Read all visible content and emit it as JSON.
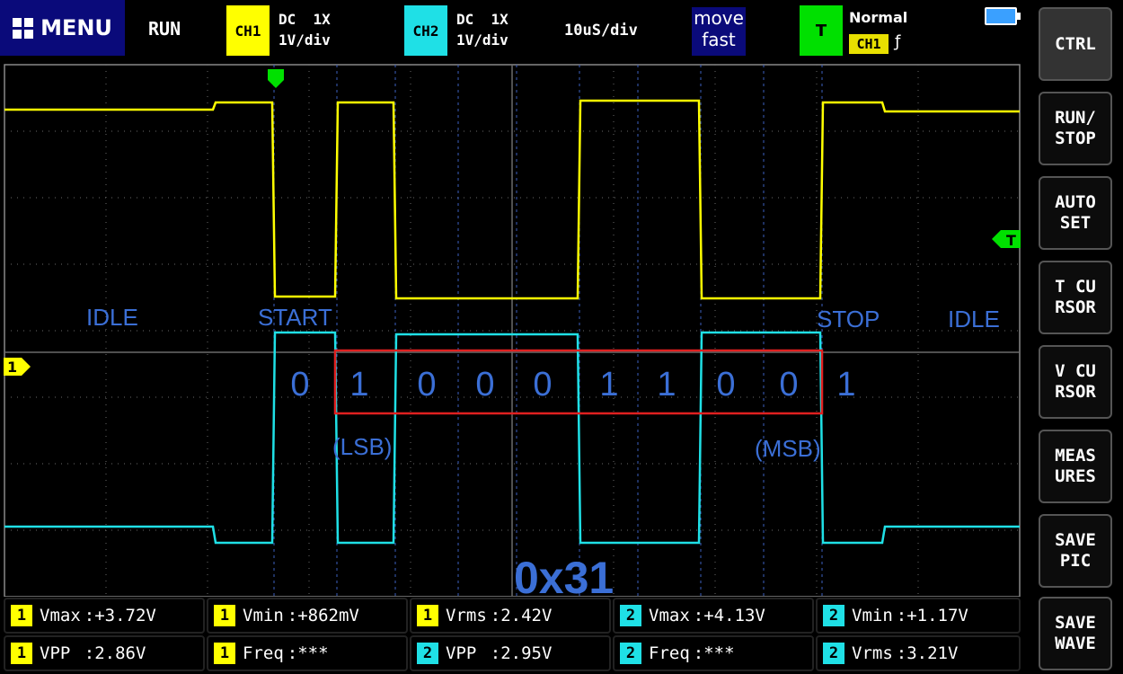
{
  "menu": {
    "label": "MENU"
  },
  "run_state": "RUN",
  "ch1": {
    "badge": "CH1",
    "coupling": "DC  1X",
    "scale": "1V/div"
  },
  "ch2": {
    "badge": "CH2",
    "coupling": "DC  1X",
    "scale": "1V/div"
  },
  "timebase": "10uS/div",
  "move": {
    "line1": "move",
    "line2": "fast"
  },
  "trigger": {
    "badge": "T",
    "mode": "Normal",
    "source": "CH1",
    "edge": "ƒ"
  },
  "sidebar": {
    "items": [
      {
        "label": "CTRL"
      },
      {
        "label": "RUN/\nSTOP"
      },
      {
        "label": "AUTO\nSET"
      },
      {
        "label": "T CU\nRSOR"
      },
      {
        "label": "V CU\nRSOR"
      },
      {
        "label": "MEAS\nURES"
      },
      {
        "label": "SAVE\nPIC"
      },
      {
        "label": "SAVE\nWAVE"
      }
    ]
  },
  "screen": {
    "ch1_marker": "1",
    "trigger_marker": "T",
    "annotations": {
      "idle_left": "IDLE",
      "start": "START",
      "stop": "STOP",
      "idle_right": "IDLE",
      "lsb": "(LSB)",
      "msb": "(MSB)",
      "hex": "0x31"
    },
    "bits": [
      "0",
      "1",
      "0",
      "0",
      "0",
      "1",
      "1",
      "0",
      "0",
      "1"
    ]
  },
  "measurements": [
    {
      "channel": "1",
      "label": "Vmax",
      "value": "+3.72V"
    },
    {
      "channel": "1",
      "label": "Vmin",
      "value": "+862mV"
    },
    {
      "channel": "1",
      "label": "Vrms",
      "value": "2.42V"
    },
    {
      "channel": "2",
      "label": "Vmax",
      "value": "+4.13V"
    },
    {
      "channel": "2",
      "label": "Vmin",
      "value": "+1.17V"
    },
    {
      "channel": "1",
      "label": "VPP ",
      "value": "2.86V"
    },
    {
      "channel": "1",
      "label": "Freq",
      "value": "***"
    },
    {
      "channel": "2",
      "label": "VPP ",
      "value": "2.95V"
    },
    {
      "channel": "2",
      "label": "Freq",
      "value": "***"
    },
    {
      "channel": "2",
      "label": "Vrms",
      "value": "3.21V"
    }
  ],
  "colors": {
    "ch1": "#ffff00",
    "ch2": "#1fe0e6",
    "annotation": "#3b6fd6",
    "frame": "#e02020",
    "grid": "#6a6a6a"
  }
}
